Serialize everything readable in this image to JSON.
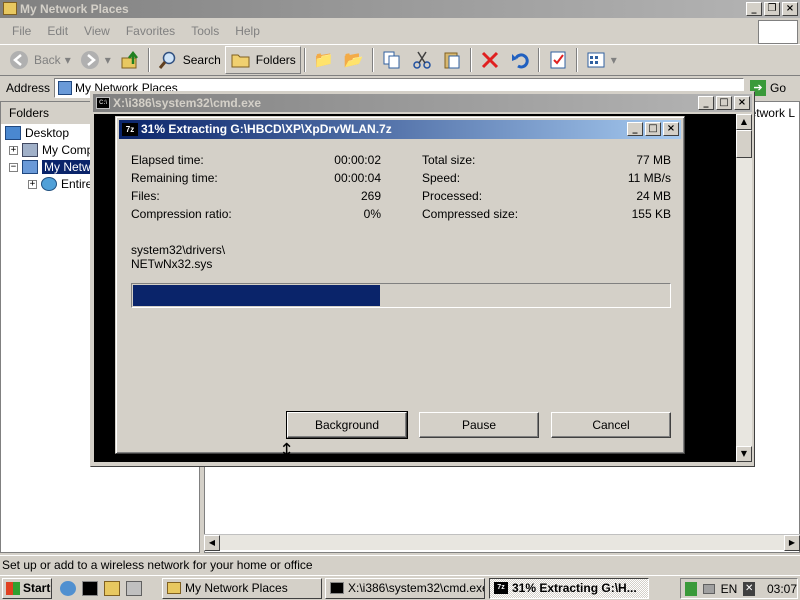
{
  "explorer": {
    "title": "My Network Places",
    "menu": [
      "File",
      "Edit",
      "View",
      "Favorites",
      "Tools",
      "Help"
    ],
    "toolbar": {
      "back": "Back",
      "search": "Search",
      "folders": "Folders"
    },
    "address": {
      "label": "Address",
      "value": "My Network Places",
      "go": "Go"
    },
    "folders_header": "Folders",
    "tree": {
      "desktop": "Desktop",
      "my_computer": "My Computer",
      "my_network": "My Network Places",
      "entire": "Entire Network"
    },
    "right_header_partial": "Network L",
    "status_text": "Set up or add to a wireless network for your home or office"
  },
  "cmd_window": {
    "title": "X:\\i386\\system32\\cmd.exe"
  },
  "dialog": {
    "title": "31% Extracting G:\\HBCD\\XP\\XpDrvWLAN.7z",
    "icon_text": "7z",
    "left_stats": [
      {
        "label": "Elapsed time:",
        "value": "00:00:02"
      },
      {
        "label": "Remaining time:",
        "value": "00:00:04"
      },
      {
        "label": "Files:",
        "value": "269"
      },
      {
        "label": "Compression ratio:",
        "value": "0%"
      }
    ],
    "right_stats": [
      {
        "label": "Total size:",
        "value": "77 MB"
      },
      {
        "label": "Speed:",
        "value": "11 MB/s"
      },
      {
        "label": "Processed:",
        "value": "24 MB"
      },
      {
        "label": "Compressed size:",
        "value": "155 KB"
      }
    ],
    "current_path": "system32\\drivers\\",
    "current_file": "NETwNx32.sys",
    "progress_percent": 46,
    "buttons": {
      "background": "Background",
      "pause": "Pause",
      "cancel": "Cancel"
    }
  },
  "taskbar": {
    "start": "Start",
    "tasks": [
      {
        "label": "My Network Places"
      },
      {
        "label": "X:\\i386\\system32\\cmd.exe"
      },
      {
        "label": "31% Extracting G:\\H..."
      }
    ],
    "lang": "EN",
    "clock": "03:07"
  },
  "colors": {
    "active_title": "#0a246a",
    "inactive_title": "#808080",
    "face": "#d4d0c8",
    "progress": "#0a246a"
  }
}
